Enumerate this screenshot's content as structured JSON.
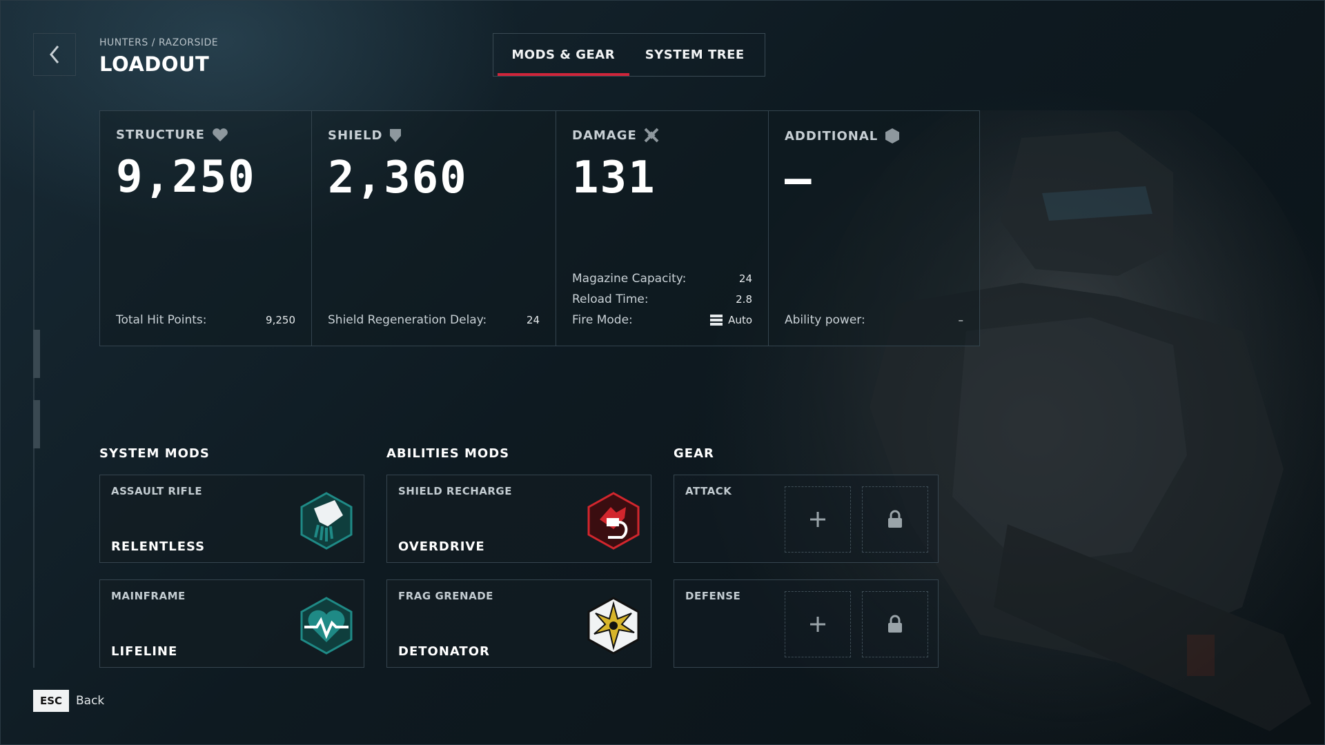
{
  "header": {
    "breadcrumb": "HUNTERS / RAZORSIDE",
    "title": "LOADOUT",
    "tabs": [
      {
        "label": "MODS & GEAR",
        "active": true
      },
      {
        "label": "SYSTEM TREE",
        "active": false
      }
    ]
  },
  "stats": {
    "structure": {
      "label": "STRUCTURE",
      "icon": "heart-icon",
      "value": "9,250",
      "rows": [
        {
          "label": "Total Hit Points:",
          "value": "9,250"
        }
      ]
    },
    "shield": {
      "label": "SHIELD",
      "icon": "shield-icon",
      "value": "2,360",
      "rows": [
        {
          "label": "Shield Regeneration Delay:",
          "value": "24"
        }
      ]
    },
    "damage": {
      "label": "DAMAGE",
      "icon": "crossed-swords-icon",
      "value": "131",
      "rows": [
        {
          "label": "Magazine Capacity:",
          "value": "24"
        },
        {
          "label": "Reload Time:",
          "value": "2.8"
        },
        {
          "label": "Fire Mode:",
          "value": "Auto",
          "icon": "ammo-icon"
        }
      ]
    },
    "additional": {
      "label": "ADDITIONAL",
      "icon": "hexagon-icon",
      "value": "—",
      "rows": [
        {
          "label": "Ability power:",
          "value": "–"
        }
      ]
    }
  },
  "sections": {
    "system_mods": {
      "title": "SYSTEM MODS",
      "cards": [
        {
          "kind": "ASSAULT RIFLE",
          "name": "RELENTLESS",
          "icon": "relentless-mod-icon"
        },
        {
          "kind": "MAINFRAME",
          "name": "LIFELINE",
          "icon": "lifeline-mod-icon"
        }
      ]
    },
    "abilities_mods": {
      "title": "ABILITIES MODS",
      "cards": [
        {
          "kind": "SHIELD RECHARGE",
          "name": "OVERDRIVE",
          "icon": "overdrive-mod-icon"
        },
        {
          "kind": "FRAG GRENADE",
          "name": "DETONATOR",
          "icon": "detonator-mod-icon"
        }
      ]
    },
    "gear": {
      "title": "GEAR",
      "slots": [
        {
          "kind": "ATTACK",
          "icons": [
            "plus-icon",
            "lock-icon"
          ]
        },
        {
          "kind": "DEFENSE",
          "icons": [
            "plus-icon",
            "lock-icon"
          ]
        }
      ]
    }
  },
  "footer": {
    "key": "ESC",
    "label": "Back"
  },
  "colors": {
    "accent": "#d0253a",
    "teal": "#1f8a86",
    "red_icon": "#d2262d",
    "gold": "#d8b52a"
  }
}
